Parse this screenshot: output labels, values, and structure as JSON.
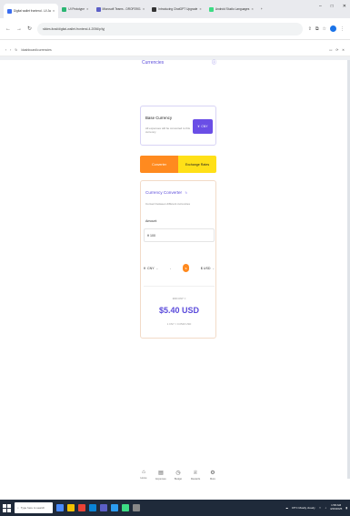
{
  "browser": {
    "tabs": [
      {
        "label": "Digital wallet frontend - UI Ja",
        "active": true
      },
      {
        "label": "UI Prototype",
        "active": false
      },
      {
        "label": "Microsoft Teams - DROP2901",
        "active": false
      },
      {
        "label": "Introducing ChatGPT Upgrade",
        "active": false
      },
      {
        "label": "Android Studio Languages",
        "active": false
      }
    ],
    "new_tab": "+",
    "window_controls": [
      "–",
      "□",
      "✕"
    ],
    "url": "slides.itrad/digital-wallet-frontend-4-2056/p/lyj"
  },
  "inner_bar": {
    "path": "/dashboard/currencies"
  },
  "page": {
    "title": "Currencies",
    "base_currency": {
      "title": "Base Currency",
      "description": "All expenses will be converted to this currency",
      "button_label": "CNY"
    },
    "toggle": {
      "convert_label": "Converter",
      "rates_label": "Exchange Rates",
      "active": "convert"
    },
    "converter": {
      "title": "Currency Converter",
      "subtitle": "Convert between different currencies",
      "amount_label": "Amount",
      "amount_value": "¥ 100",
      "from_currency": "CNY",
      "to_currency": "$ USD",
      "result_small": "100 CNY =",
      "result_big": "$5.40 USD",
      "rate_text": "1 CNY = 0.0540 USD"
    }
  },
  "bottom_nav": [
    {
      "label": "Home",
      "icon": "home-icon"
    },
    {
      "label": "Expenses",
      "icon": "wallet-icon"
    },
    {
      "label": "Budget",
      "icon": "budget-icon"
    },
    {
      "label": "Rewards",
      "icon": "trophy-icon"
    },
    {
      "label": "More",
      "icon": "more-icon"
    }
  ],
  "taskbar": {
    "search_placeholder": "Type here to search",
    "weather": "15°C Mostly cloudy",
    "time": "1:58 AM",
    "date": "4/29/2025"
  },
  "colors": {
    "accent_purple": "#6a4ee6",
    "accent_orange": "#ff8a1f",
    "accent_yellow": "#ffe018"
  }
}
